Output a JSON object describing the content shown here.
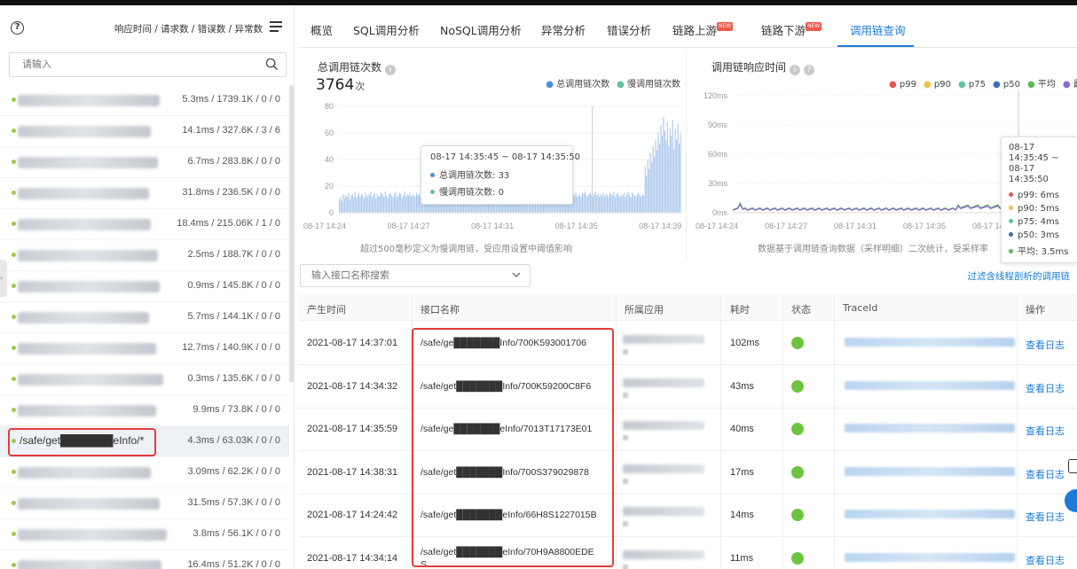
{
  "left": {
    "sort_label": "响应时间 / 请求数 / 错误数 / 异常数",
    "search_placeholder": "请输入",
    "items": [
      {
        "name": "",
        "blur_w": 160,
        "stat": "5.3ms / 1739.1K / 0 / 0"
      },
      {
        "name": "",
        "blur_w": 150,
        "stat": "14.1ms / 327.6K / 3 / 6"
      },
      {
        "name": "",
        "blur_w": 158,
        "stat": "6.7ms / 283.8K / 0 / 0"
      },
      {
        "name": "",
        "blur_w": 148,
        "stat": "31.8ms / 236.5K / 0 / 0"
      },
      {
        "name": "",
        "blur_w": 150,
        "stat": "18.4ms / 215.06K / 1 / 0"
      },
      {
        "name": "",
        "blur_w": 158,
        "stat": "2.5ms / 188.7K / 0 / 0"
      },
      {
        "name": "",
        "blur_w": 160,
        "stat": "0.9ms / 145.8K / 0 / 0"
      },
      {
        "name": "",
        "blur_w": 148,
        "stat": "5.7ms / 144.1K / 0 / 0"
      },
      {
        "name": "",
        "blur_w": 156,
        "stat": "12.7ms / 140.9K / 0 / 0"
      },
      {
        "name": "",
        "blur_w": 164,
        "stat": "0.3ms / 135.6K / 0 / 0"
      },
      {
        "name": "",
        "blur_w": 156,
        "stat": "9.9ms / 73.8K / 0 / 0"
      },
      {
        "name": "/safe/get███████eInfo/*",
        "blur_w": 0,
        "stat": "4.3ms / 63.03K / 0 / 0"
      },
      {
        "name": "",
        "blur_w": 150,
        "stat": "3.09ms / 62.2K / 0 / 0"
      },
      {
        "name": "",
        "blur_w": 160,
        "stat": "31.5ms / 57.3K / 0 / 0"
      },
      {
        "name": "",
        "blur_w": 168,
        "stat": "3.8ms / 56.1K / 0 / 0"
      },
      {
        "name": "",
        "blur_w": 162,
        "stat": "16.4ms / 51.2K / 0 / 0"
      }
    ]
  },
  "tabs": [
    {
      "label": "概览"
    },
    {
      "label": "SQL调用分析"
    },
    {
      "label": "NoSQL调用分析"
    },
    {
      "label": "异常分析"
    },
    {
      "label": "错误分析"
    },
    {
      "label": "链路上游",
      "badge": "NEW"
    },
    {
      "label": "链路下游",
      "badge": "NEW"
    },
    {
      "label": "调用链查询",
      "active": true
    }
  ],
  "chart1": {
    "title": "总调用链次数",
    "total": "3764",
    "total_unit": "次",
    "legend": [
      {
        "name": "总调用链次数",
        "color": "#4a8fd9"
      },
      {
        "name": "慢调用链次数",
        "color": "#5dc49a"
      }
    ],
    "note": "超过500毫秒定义为慢调用链，受应用设置中阈值影响",
    "tooltip": {
      "title": "08-17 14:35:45 ~ 08-17 14:35:50",
      "rows": [
        {
          "label": "总调用链次数:",
          "value": "33",
          "color": "#4a8fd9"
        },
        {
          "label": "慢调用链次数:",
          "value": "0",
          "color": "#5dc49a"
        }
      ]
    }
  },
  "chart2": {
    "title": "调用链响应时间",
    "legend": [
      {
        "name": "p99",
        "color": "#e85454"
      },
      {
        "name": "p90",
        "color": "#f0c24b"
      },
      {
        "name": "p75",
        "color": "#5dc49a"
      },
      {
        "name": "p50",
        "color": "#3b6fb6"
      },
      {
        "name": "平均",
        "color": "#5db85c"
      },
      {
        "name": "最大",
        "color": "#8b64d6"
      }
    ],
    "note": "数据基于调用链查询数据（采样明细）二次统计，受采样率",
    "tooltip": {
      "title_lines": [
        "08-17",
        "14:35:45 ~",
        "08-17",
        "14:35:50"
      ],
      "rows": [
        {
          "label": "p99:",
          "value": "6ms",
          "color": "#e85454"
        },
        {
          "label": "p90:",
          "value": "5ms",
          "color": "#f0c24b"
        },
        {
          "label": "p75:",
          "value": "4ms",
          "color": "#5dc49a"
        },
        {
          "label": "p50:",
          "value": "3ms",
          "color": "#3b6fb6"
        },
        {
          "label": "平均:",
          "value": "3.5ms",
          "color": "#5db85c"
        }
      ]
    }
  },
  "chart_data": [
    {
      "type": "bar",
      "title": "总调用链次数",
      "ylim": [
        0,
        80
      ],
      "yticks": [
        0,
        20,
        40,
        60,
        80
      ],
      "xticks": [
        "08-17 14:24",
        "08-17 14:27",
        "08-17 14:31",
        "08-17 14:35",
        "08-17 14:39"
      ],
      "series": [
        {
          "name": "总调用链次数",
          "color": "#a9c7ec",
          "values": [
            10,
            12,
            9,
            14,
            11,
            13,
            12,
            15,
            10,
            13,
            14,
            12,
            16,
            11,
            13,
            15,
            12,
            14,
            13,
            11,
            15,
            12,
            14,
            13,
            16,
            12,
            13,
            15,
            11,
            14,
            12,
            13,
            15,
            14,
            12,
            16,
            13,
            11,
            14,
            15,
            13,
            12,
            14,
            16,
            12,
            13,
            15,
            14,
            11,
            13,
            16,
            12,
            14,
            13,
            15,
            12,
            14,
            13,
            12,
            15,
            13,
            14,
            12,
            16,
            13,
            15,
            12,
            14,
            13,
            12,
            15,
            14,
            13,
            12,
            14,
            16,
            13,
            12,
            15,
            13,
            14,
            12,
            13,
            15,
            14,
            12,
            13,
            16,
            14,
            13,
            12,
            15,
            13,
            14,
            12,
            13,
            15,
            14,
            13,
            12,
            14,
            16,
            13,
            15,
            12,
            14,
            13,
            12,
            15,
            14,
            13,
            12,
            14,
            15,
            13,
            12,
            14,
            16,
            13,
            15,
            12,
            14,
            13,
            15,
            12,
            14,
            13,
            16,
            12,
            15,
            14,
            13,
            12,
            14,
            15,
            13,
            12,
            16,
            14,
            13,
            15,
            12,
            14,
            13,
            15,
            12,
            14,
            13,
            12,
            15,
            14,
            13,
            16,
            12,
            14,
            15,
            13,
            12,
            14,
            13,
            15,
            12,
            14,
            16,
            13,
            12,
            15,
            14,
            13,
            12,
            14,
            15,
            13,
            12,
            16,
            14,
            13,
            15,
            12,
            14,
            13,
            15,
            12,
            14,
            13,
            12,
            15,
            14,
            16,
            13,
            12,
            14,
            15,
            13,
            12,
            14,
            16,
            13,
            15,
            12,
            14,
            13,
            15,
            12,
            14,
            13,
            12,
            15,
            14,
            13,
            16,
            12,
            14,
            15,
            13,
            12,
            14,
            13,
            15,
            12,
            14,
            16,
            13,
            12,
            15,
            14,
            13,
            12,
            14,
            15,
            13,
            12,
            14,
            13,
            35,
            28,
            40,
            33,
            45,
            38,
            50,
            42,
            55,
            47,
            60,
            52,
            66,
            58,
            72,
            62,
            55,
            68,
            50,
            64,
            58,
            70,
            48,
            63,
            55,
            67,
            52,
            60
          ]
        },
        {
          "name": "慢调用链次数",
          "color": "#5dc49a",
          "values": []
        }
      ],
      "tooltip_highlight": {
        "x": "08-17 14:35:45 ~ 08-17 14:35:50",
        "total": 33,
        "slow": 0
      }
    },
    {
      "type": "line",
      "title": "调用链响应时间",
      "ylim": [
        0,
        120
      ],
      "yticks_labels": [
        "0ms",
        "30ms",
        "60ms",
        "90ms",
        "120ms"
      ],
      "xticks": [
        "08-17 14:24",
        "08-17 14:27",
        "08-17 14:31",
        "08-17 14:35",
        "08-17 14:39"
      ],
      "series": [
        {
          "name": "p99",
          "color": "#e85454"
        },
        {
          "name": "p90",
          "color": "#f0c24b"
        },
        {
          "name": "p75",
          "color": "#5dc49a"
        },
        {
          "name": "p50",
          "color": "#3b6fb6"
        },
        {
          "name": "平均",
          "color": "#5db85c",
          "values": [
            3,
            3,
            4,
            3,
            8,
            3,
            3,
            4,
            3,
            3,
            4,
            3,
            4,
            3,
            3,
            4,
            3,
            3,
            4,
            3,
            4,
            5,
            4,
            5,
            6,
            30,
            5,
            6,
            20,
            5,
            6,
            5,
            6
          ]
        },
        {
          "name": "最大",
          "color": "#8b64d6",
          "values": [
            3,
            3,
            4,
            3,
            8,
            3,
            3,
            4,
            3,
            3,
            4,
            3,
            4,
            3,
            3,
            4,
            3,
            3,
            4,
            3,
            4,
            5,
            4,
            5,
            6,
            30,
            5,
            6,
            20,
            5,
            6,
            5,
            6
          ]
        }
      ],
      "spikes": [
        {
          "at": "08-17 14:35",
          "value": 120
        },
        {
          "at": "08-17 14:39",
          "value": 55
        }
      ]
    }
  ],
  "filter": {
    "placeholder": "输入接口名称搜索",
    "link": "过滤含线程剖析的调用链"
  },
  "table": {
    "headers": [
      "产生时间",
      "接口名称",
      "所属应用",
      "耗时",
      "状态",
      "TraceId",
      "操作"
    ],
    "rows": [
      {
        "time": "2021-08-17 14:37:01",
        "api": "/safe/ge███████Info/700K593001706",
        "duration": "102ms",
        "op": "查看日志"
      },
      {
        "time": "2021-08-17 14:34:32",
        "api": "/safe/get███████Info/700K59200C8F6",
        "duration": "43ms",
        "op": "查看日志"
      },
      {
        "time": "2021-08-17 14:35:59",
        "api": "/safe/ge███████eInfo/7013T17173E01",
        "duration": "40ms",
        "op": "查看日志"
      },
      {
        "time": "2021-08-17 14:38:31",
        "api": "/safe/get███████Info/700S379029878",
        "duration": "17ms",
        "op": "查看日志"
      },
      {
        "time": "2021-08-17 14:24:42",
        "api": "/safe/get███████eInfo/66H8S1227015B",
        "duration": "14ms",
        "op": "查看日志"
      },
      {
        "time": "2021-08-17 14:34:14",
        "api": "/safe/get███████eInfo/70H9A8800EDE",
        "api2": "S",
        "duration": "11ms",
        "op": "查看日志"
      }
    ]
  }
}
